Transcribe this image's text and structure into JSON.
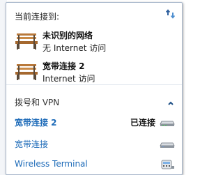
{
  "header": {
    "title": "当前连接到:",
    "refresh_icon": "refresh-icon"
  },
  "current_connections": [
    {
      "name": "未识别的网络",
      "status": "无 Internet 访问",
      "icon": "bench-network-icon"
    },
    {
      "name": "宽带连接 2",
      "status": "Internet 访问",
      "icon": "bench-network-icon"
    }
  ],
  "dialup_section": {
    "title": "拨号和 VPN",
    "collapse_icon": "chevron-up-icon",
    "items": [
      {
        "label": "宽带连接 2",
        "state": "已连接",
        "icon": "modem-icon"
      },
      {
        "label": "宽带连接",
        "icon": "modem-icon"
      },
      {
        "label": "Wireless Terminal",
        "icon": "phone-modem-icon"
      }
    ]
  },
  "colors": {
    "link": "#1c6ab8",
    "panel_border": "#a9b8cc",
    "bench_wood": "#b9793a"
  }
}
